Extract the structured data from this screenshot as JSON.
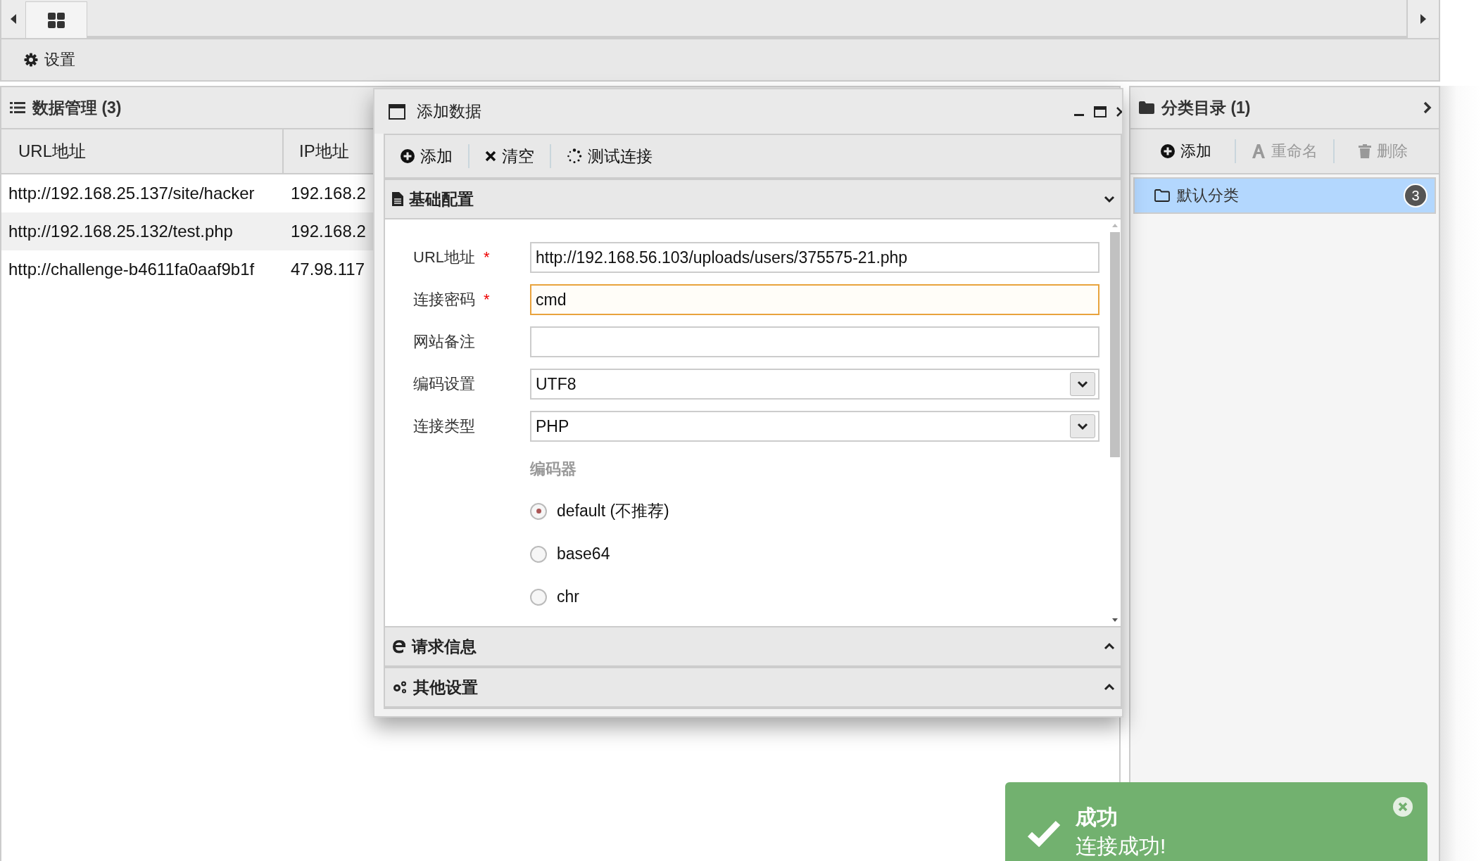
{
  "toolbar": {
    "items": [
      {
        "label": "设置"
      }
    ]
  },
  "data_panel": {
    "title": "数据管理 (3)",
    "columns": [
      "URL地址",
      "IP地址"
    ],
    "rows": [
      {
        "cells": [
          "http://192.168.25.137/site/hacker",
          "192.168.2"
        ]
      },
      {
        "cells": [
          "http://192.168.25.132/test.php",
          "192.168.2"
        ]
      },
      {
        "cells": [
          "http://challenge-b4611fa0aaf9b1f",
          "47.98.117"
        ]
      }
    ]
  },
  "dialog": {
    "title": "添加数据",
    "toolbar": [
      {
        "label": "添加"
      },
      {
        "label": "清空"
      },
      {
        "label": "测试连接"
      }
    ],
    "sections": [
      {
        "title": "基础配置",
        "expanded": true,
        "fields": [
          {
            "kind": "text",
            "label": "URL地址",
            "required_mark": "*",
            "focused": false,
            "value": "http://192.168.56.103/uploads/users/375575-21.php"
          },
          {
            "kind": "text",
            "label": "连接密码",
            "required_mark": "*",
            "focused": true,
            "value": "cmd"
          },
          {
            "kind": "text",
            "label": "网站备注",
            "focused": false
          },
          {
            "kind": "select",
            "label": "编码设置",
            "value": "UTF8"
          },
          {
            "kind": "select",
            "label": "连接类型",
            "value": "PHP"
          }
        ],
        "encoder": {
          "label": "编码器",
          "options": [
            {
              "label": "default (不推荐)",
              "selected": true
            },
            {
              "label": "base64",
              "selected": false
            },
            {
              "label": "chr",
              "selected": false
            }
          ]
        }
      },
      {
        "title": "请求信息",
        "expanded": false
      },
      {
        "title": "其他设置",
        "expanded": false
      }
    ]
  },
  "category_panel": {
    "title": "分类目录 (1)",
    "toolbar": [
      {
        "label": "添加",
        "disabled": false
      },
      {
        "label": "重命名",
        "disabled": true
      },
      {
        "label": "删除",
        "disabled": true
      }
    ],
    "items": [
      {
        "label": "默认分类",
        "count": "3",
        "selected": true
      }
    ]
  },
  "toast": {
    "title": "成功",
    "message": "连接成功!"
  }
}
